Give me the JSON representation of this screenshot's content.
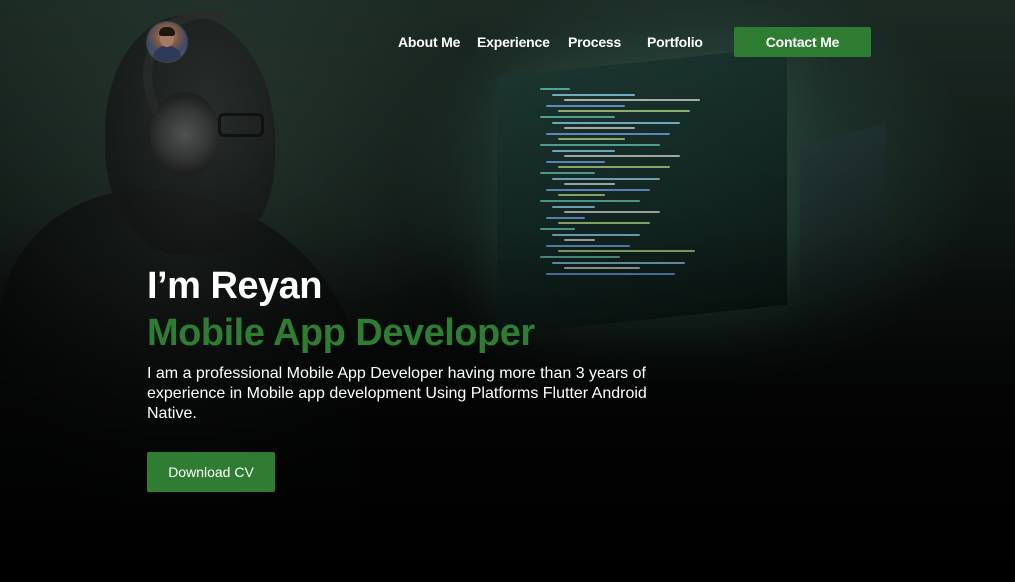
{
  "nav": {
    "items": [
      {
        "label": "About Me"
      },
      {
        "label": "Experience"
      },
      {
        "label": "Process"
      },
      {
        "label": "Portfolio"
      }
    ],
    "contact_label": "Contact Me"
  },
  "hero": {
    "greeting": "I’m Reyan",
    "role": "Mobile App Developer",
    "bio": "I am a professional Mobile App Developer having more than 3 years of experience in Mobile app development Using Platforms Flutter Android Native.",
    "cta_label": "Download CV"
  },
  "colors": {
    "accent": "#2e7d32",
    "text": "#ffffff",
    "background": "#050806"
  }
}
